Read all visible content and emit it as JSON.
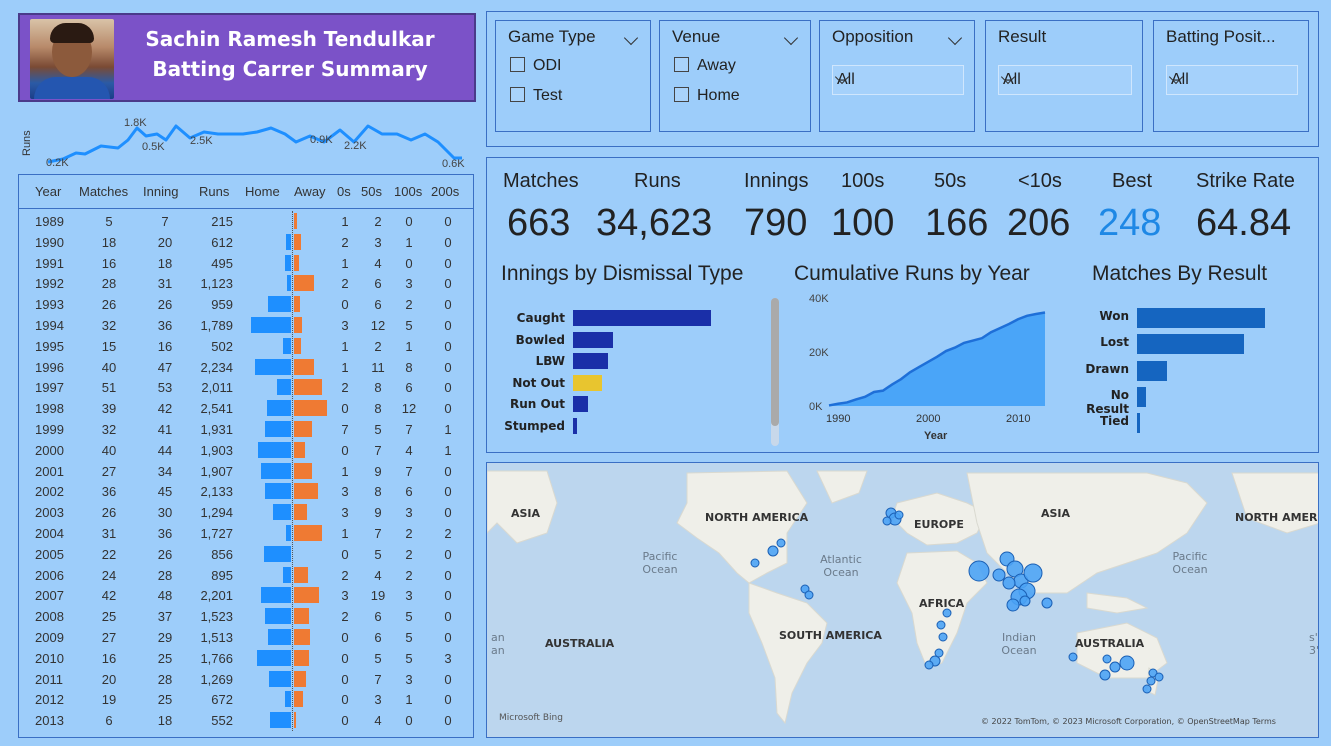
{
  "header": {
    "title_line1": "Sachin Ramesh Tendulkar",
    "title_line2": "Batting Carrer Summary"
  },
  "sparkline": {
    "ylabel": "Runs",
    "labels": [
      "0.2K",
      "1.8K",
      "0.5K",
      "2.5K",
      "0.9K",
      "2.2K",
      "0.6K"
    ]
  },
  "table": {
    "headers": [
      "Year",
      "Matches",
      "Inning",
      "Runs",
      "Home",
      "Away",
      "0s",
      "50s",
      "100s",
      "200s"
    ],
    "rows": [
      {
        "year": "1989",
        "matches": "5",
        "innings": "7",
        "runs": "215",
        "home": 0,
        "away": 0.1,
        "zero": "1",
        "fifty": "2",
        "hundred": "0",
        "double": "0"
      },
      {
        "year": "1990",
        "matches": "18",
        "innings": "20",
        "runs": "612",
        "home": 0.12,
        "away": 0.22,
        "zero": "2",
        "fifty": "3",
        "hundred": "1",
        "double": "0"
      },
      {
        "year": "1991",
        "matches": "16",
        "innings": "18",
        "runs": "495",
        "home": 0.14,
        "away": 0.16,
        "zero": "1",
        "fifty": "4",
        "hundred": "0",
        "double": "0"
      },
      {
        "year": "1992",
        "matches": "28",
        "innings": "31",
        "runs": "1,123",
        "home": 0.1,
        "away": 0.6,
        "zero": "2",
        "fifty": "6",
        "hundred": "3",
        "double": "0"
      },
      {
        "year": "1993",
        "matches": "26",
        "innings": "26",
        "runs": "959",
        "home": 0.58,
        "away": 0.18,
        "zero": "0",
        "fifty": "6",
        "hundred": "2",
        "double": "0"
      },
      {
        "year": "1994",
        "matches": "32",
        "innings": "36",
        "runs": "1,789",
        "home": 1.0,
        "away": 0.24,
        "zero": "3",
        "fifty": "12",
        "hundred": "5",
        "double": "0"
      },
      {
        "year": "1995",
        "matches": "15",
        "innings": "16",
        "runs": "502",
        "home": 0.2,
        "away": 0.2,
        "zero": "1",
        "fifty": "2",
        "hundred": "1",
        "double": "0"
      },
      {
        "year": "1996",
        "matches": "40",
        "innings": "47",
        "runs": "2,234",
        "home": 0.9,
        "away": 0.6,
        "zero": "1",
        "fifty": "11",
        "hundred": "8",
        "double": "0"
      },
      {
        "year": "1997",
        "matches": "51",
        "innings": "53",
        "runs": "2,011",
        "home": 0.36,
        "away": 0.86,
        "zero": "2",
        "fifty": "8",
        "hundred": "6",
        "double": "0"
      },
      {
        "year": "1998",
        "matches": "39",
        "innings": "42",
        "runs": "2,541",
        "home": 0.6,
        "away": 1.0,
        "zero": "0",
        "fifty": "8",
        "hundred": "12",
        "double": "0"
      },
      {
        "year": "1999",
        "matches": "32",
        "innings": "41",
        "runs": "1,931",
        "home": 0.66,
        "away": 0.54,
        "zero": "7",
        "fifty": "5",
        "hundred": "7",
        "double": "1"
      },
      {
        "year": "2000",
        "matches": "40",
        "innings": "44",
        "runs": "1,903",
        "home": 0.82,
        "away": 0.34,
        "zero": "0",
        "fifty": "7",
        "hundred": "4",
        "double": "1"
      },
      {
        "year": "2001",
        "matches": "27",
        "innings": "34",
        "runs": "1,907",
        "home": 0.74,
        "away": 0.54,
        "zero": "1",
        "fifty": "9",
        "hundred": "7",
        "double": "0"
      },
      {
        "year": "2002",
        "matches": "36",
        "innings": "45",
        "runs": "2,133",
        "home": 0.66,
        "away": 0.72,
        "zero": "3",
        "fifty": "8",
        "hundred": "6",
        "double": "0"
      },
      {
        "year": "2003",
        "matches": "26",
        "innings": "30",
        "runs": "1,294",
        "home": 0.44,
        "away": 0.38,
        "zero": "3",
        "fifty": "9",
        "hundred": "3",
        "double": "0"
      },
      {
        "year": "2004",
        "matches": "31",
        "innings": "36",
        "runs": "1,727",
        "home": 0.12,
        "away": 0.86,
        "zero": "1",
        "fifty": "7",
        "hundred": "2",
        "double": "2"
      },
      {
        "year": "2005",
        "matches": "22",
        "innings": "26",
        "runs": "856",
        "home": 0.68,
        "away": 0.0,
        "zero": "0",
        "fifty": "5",
        "hundred": "2",
        "double": "0"
      },
      {
        "year": "2006",
        "matches": "24",
        "innings": "28",
        "runs": "895",
        "home": 0.2,
        "away": 0.42,
        "zero": "2",
        "fifty": "4",
        "hundred": "2",
        "double": "0"
      },
      {
        "year": "2007",
        "matches": "42",
        "innings": "48",
        "runs": "2,201",
        "home": 0.74,
        "away": 0.76,
        "zero": "3",
        "fifty": "19",
        "hundred": "3",
        "double": "0"
      },
      {
        "year": "2008",
        "matches": "25",
        "innings": "37",
        "runs": "1,523",
        "home": 0.66,
        "away": 0.46,
        "zero": "2",
        "fifty": "6",
        "hundred": "5",
        "double": "0"
      },
      {
        "year": "2009",
        "matches": "27",
        "innings": "29",
        "runs": "1,513",
        "home": 0.58,
        "away": 0.48,
        "zero": "0",
        "fifty": "6",
        "hundred": "5",
        "double": "0"
      },
      {
        "year": "2010",
        "matches": "16",
        "innings": "25",
        "runs": "1,766",
        "home": 0.84,
        "away": 0.46,
        "zero": "0",
        "fifty": "5",
        "hundred": "5",
        "double": "3"
      },
      {
        "year": "2011",
        "matches": "20",
        "innings": "28",
        "runs": "1,269",
        "home": 0.56,
        "away": 0.36,
        "zero": "0",
        "fifty": "7",
        "hundred": "3",
        "double": "0"
      },
      {
        "year": "2012",
        "matches": "19",
        "innings": "25",
        "runs": "672",
        "home": 0.16,
        "away": 0.28,
        "zero": "0",
        "fifty": "3",
        "hundred": "1",
        "double": "0"
      },
      {
        "year": "2013",
        "matches": "6",
        "innings": "18",
        "runs": "552",
        "home": 0.52,
        "away": 0.06,
        "zero": "0",
        "fifty": "4",
        "hundred": "0",
        "double": "0"
      }
    ]
  },
  "filters": {
    "game_type": {
      "label": "Game Type",
      "options": [
        "ODI",
        "Test"
      ]
    },
    "venue": {
      "label": "Venue",
      "options": [
        "Away",
        "Home"
      ]
    },
    "opposition": {
      "label": "Opposition",
      "value": "All"
    },
    "result": {
      "label": "Result",
      "value": "All"
    },
    "batting_position": {
      "label": "Batting Posit...",
      "value": "All"
    }
  },
  "kpis": {
    "labels": [
      "Matches",
      "Runs",
      "Innings",
      "100s",
      "50s",
      "<10s",
      "Best",
      "Strike Rate"
    ],
    "values": [
      "663",
      "34,623",
      "790",
      "100",
      "166",
      "206",
      "248",
      "64.84"
    ]
  },
  "colors": {
    "background": "#9dcdfa",
    "header_bg": "#7b52c8",
    "home_bar": "#1e8fff",
    "away_bar": "#ef7a33",
    "dismissal_bar": "#1a2fa8",
    "dismissal_highlight": "#e8c52f",
    "result_bar": "#1565c0",
    "best_value": "#1e88e5"
  },
  "charts": {
    "dismissal_title": "Innings by Dismissal Type",
    "cumulative_title": "Cumulative Runs by Year",
    "result_title": "Matches By Result",
    "cumulative_xlabel": "Year"
  },
  "chart_data": [
    {
      "type": "bar",
      "orientation": "horizontal",
      "title": "Innings by Dismissal Type",
      "categories": [
        "Caught",
        "Bowled",
        "LBW",
        "Not Out",
        "Run Out",
        "Stumped"
      ],
      "values": [
        360,
        105,
        90,
        75,
        38,
        10
      ]
    },
    {
      "type": "area",
      "title": "Cumulative Runs by Year",
      "xlabel": "Year",
      "ylabel": "",
      "x": [
        1989,
        1990,
        1991,
        1992,
        1993,
        1994,
        1995,
        1996,
        1997,
        1998,
        1999,
        2000,
        2001,
        2002,
        2003,
        2004,
        2005,
        2006,
        2007,
        2008,
        2009,
        2010,
        2011,
        2012,
        2013
      ],
      "values": [
        215,
        827,
        1322,
        2445,
        3404,
        5193,
        5695,
        7929,
        9940,
        12481,
        14412,
        16315,
        18222,
        20355,
        21649,
        23376,
        24232,
        25127,
        27328,
        28851,
        30364,
        32130,
        33399,
        34071,
        34623
      ],
      "ylim": [
        0,
        40000
      ],
      "yticks": [
        "0K",
        "20K",
        "40K"
      ],
      "xticks": [
        "1990",
        "2000",
        "2010"
      ]
    },
    {
      "type": "bar",
      "orientation": "horizontal",
      "title": "Matches By Result",
      "categories": [
        "Won",
        "Lost",
        "Drawn",
        "No Result",
        "Tied"
      ],
      "values": [
        300,
        250,
        70,
        20,
        5
      ]
    }
  ],
  "map": {
    "labels": [
      "ASIA",
      "NORTH AMERICA",
      "EUROPE",
      "ASIA",
      "NORTH AMER",
      "AFRICA",
      "SOUTH AMERICA",
      "AUSTRALIA",
      "AUSTRALIA"
    ],
    "oceans": [
      "Pacific Ocean",
      "Atlantic Ocean",
      "Indian Ocean",
      "Pacific Ocean"
    ],
    "edge_left": "an",
    "edge_left2": "an",
    "edge_right": "s'",
    "edge_right2": "3'",
    "attribution": "© 2022 TomTom, © 2023 Microsoft Corporation, © OpenStreetMap  Terms",
    "logo": "Microsoft Bing"
  }
}
